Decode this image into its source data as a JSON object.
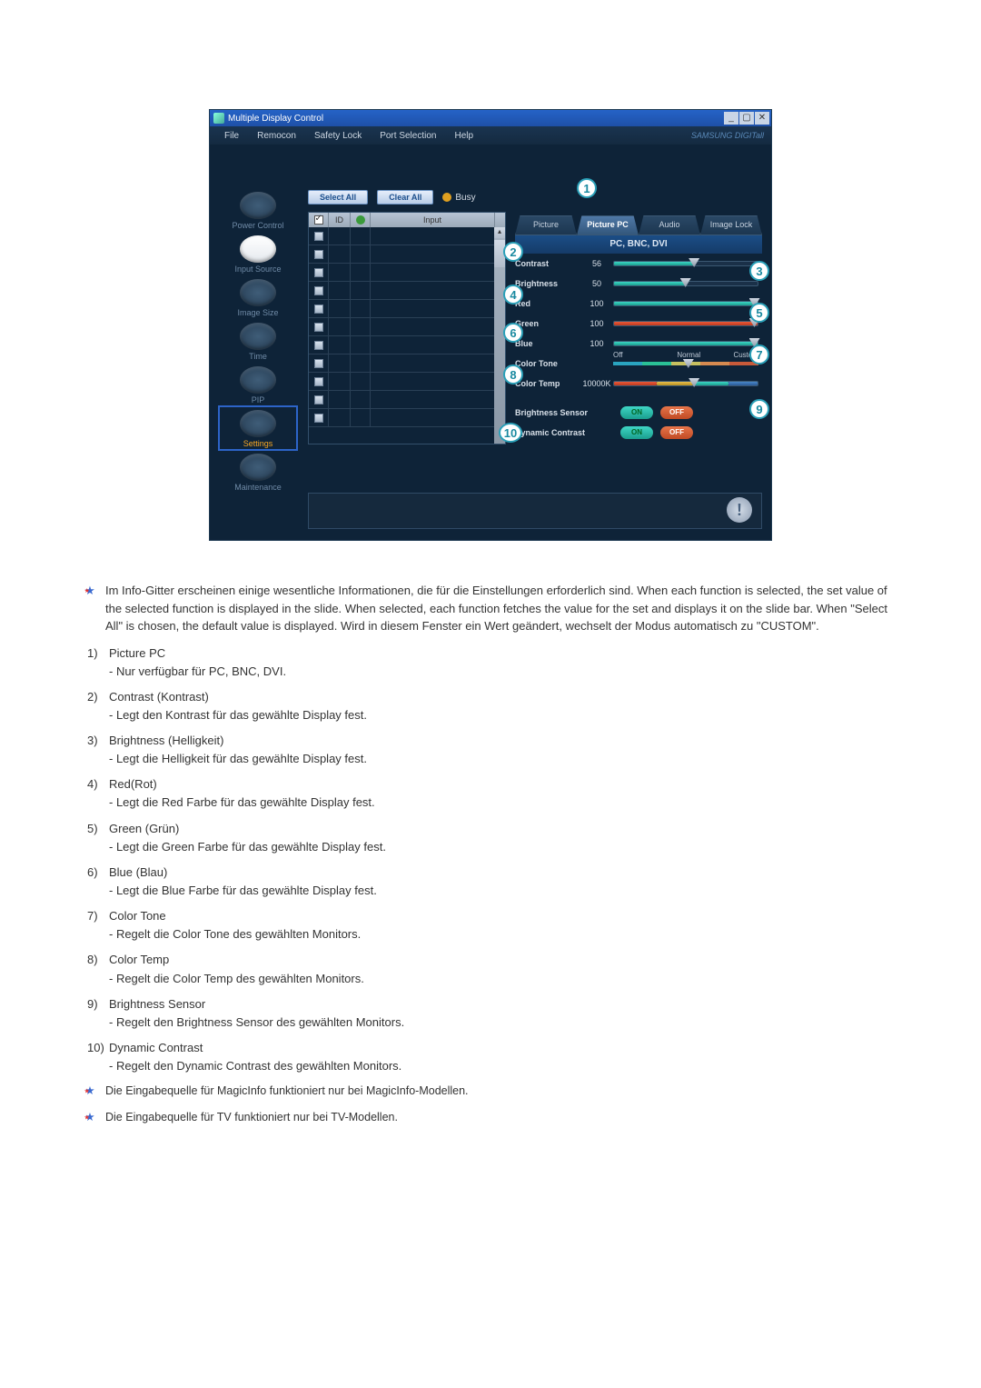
{
  "window": {
    "title": "Multiple Display Control",
    "brand": "SAMSUNG DIGITall"
  },
  "menu": [
    "File",
    "Remocon",
    "Safety Lock",
    "Port Selection",
    "Help"
  ],
  "toolbar": {
    "select_all": "Select All",
    "clear_all": "Clear All",
    "busy": "Busy"
  },
  "sidebar": {
    "items": [
      {
        "label": "Power Control"
      },
      {
        "label": "Input Source"
      },
      {
        "label": "Image Size"
      },
      {
        "label": "Time"
      },
      {
        "label": "PIP"
      },
      {
        "label": "Settings"
      },
      {
        "label": "Maintenance"
      }
    ]
  },
  "grid": {
    "headers": {
      "id": "ID",
      "input": "Input"
    }
  },
  "tabs": [
    "Picture",
    "Picture PC",
    "Audio",
    "Image Lock"
  ],
  "panel": {
    "subhead": "PC, BNC, DVI",
    "contrast": {
      "label": "Contrast",
      "value": "56",
      "pct": 56
    },
    "brightness": {
      "label": "Brightness",
      "value": "50",
      "pct": 50
    },
    "red": {
      "label": "Red",
      "value": "100",
      "pct": 100
    },
    "green": {
      "label": "Green",
      "value": "100",
      "pct": 100
    },
    "blue": {
      "label": "Blue",
      "value": "100",
      "pct": 100
    },
    "colortone": {
      "label": "Color Tone",
      "off": "Off",
      "normal": "Normal",
      "custom": "Custom"
    },
    "colortemp": {
      "label": "Color Temp",
      "value": "10000K",
      "pct": 55
    },
    "brightsensor": {
      "label": "Brightness Sensor",
      "on": "ON",
      "off": "OFF"
    },
    "dyncontrast": {
      "label": "Dynamic Contrast",
      "on": "ON",
      "off": "OFF"
    }
  },
  "callouts": [
    "1",
    "2",
    "3",
    "4",
    "5",
    "6",
    "7",
    "8",
    "9",
    "10"
  ],
  "doc": {
    "intro": "Im Info-Gitter erscheinen einige wesentliche Informationen, die für die Einstellungen erforderlich sind. When each function is selected, the set value of the selected function is displayed in the slide. When selected, each function fetches the value for the set and displays it on the slide bar. When \"Select All\" is chosen, the default value is displayed. Wird in diesem Fenster ein Wert geändert, wechselt der Modus automatisch zu \"CUSTOM\".",
    "items": [
      {
        "n": "1)",
        "t": "Picture PC",
        "s": "- Nur verfügbar für PC, BNC, DVI."
      },
      {
        "n": "2)",
        "t": "Contrast (Kontrast)",
        "s": "- Legt den Kontrast für das gewählte Display fest."
      },
      {
        "n": "3)",
        "t": "Brightness (Helligkeit)",
        "s": "- Legt die Helligkeit für das gewählte Display fest."
      },
      {
        "n": "4)",
        "t": "Red(Rot)",
        "s": "- Legt die Red Farbe für das gewählte Display fest."
      },
      {
        "n": "5)",
        "t": "Green (Grün)",
        "s": "- Legt die Green Farbe für das gewählte Display fest."
      },
      {
        "n": "6)",
        "t": "Blue (Blau)",
        "s": "- Legt die Blue Farbe für das gewählte Display fest."
      },
      {
        "n": "7)",
        "t": "Color Tone",
        "s": "- Regelt die Color Tone des gewählten Monitors."
      },
      {
        "n": "8)",
        "t": "Color Temp",
        "s": "- Regelt die Color Temp des gewählten Monitors."
      },
      {
        "n": "9)",
        "t": "Brightness Sensor",
        "s": "- Regelt den Brightness Sensor des gewählten Monitors."
      },
      {
        "n": "10)",
        "t": "Dynamic Contrast",
        "s": "- Regelt den Dynamic Contrast des gewählten Monitors."
      }
    ],
    "foot1": "Die Eingabequelle für MagicInfo funktioniert nur bei MagicInfo-Modellen.",
    "foot2": "Die Eingabequelle für TV funktioniert nur bei TV-Modellen."
  }
}
